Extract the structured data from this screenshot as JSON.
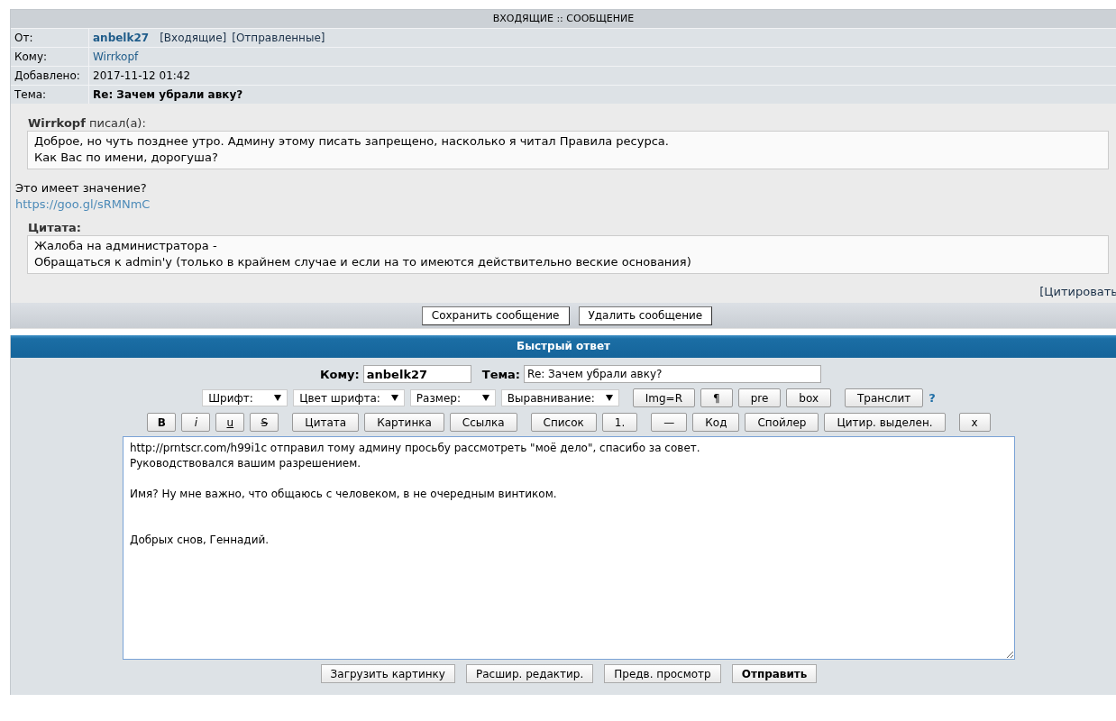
{
  "inbox": {
    "title": "ВХОДЯЩИЕ :: СООБЩЕНИЕ",
    "fields": [
      {
        "label": "От:",
        "kind": "sender",
        "value": "anbelk27",
        "links": [
          "[Входящие]",
          "[Отправленные]"
        ]
      },
      {
        "label": "Кому:",
        "kind": "link",
        "value": "Wirrkopf"
      },
      {
        "label": "Добавлено:",
        "kind": "text",
        "value": "2017-11-12 01:42"
      },
      {
        "label": "Тема:",
        "kind": "bold",
        "value": "Re: Зачем убрали авку?"
      }
    ],
    "body": [
      {
        "kind": "quote",
        "title": "**Wirrkopf** писал(а):",
        "lines": [
          "Доброе, но чуть позднее утро. Админу этому писать запрещено, насколько я читал Правила ресурса.",
          "Как Вас по имени, дорогуша?"
        ]
      },
      {
        "kind": "text",
        "text": "Это имеет значение?"
      },
      {
        "kind": "link",
        "text": "https://goo.gl/sRMNmC"
      },
      {
        "kind": "quote",
        "title": "**Цитата:**",
        "lines": [
          "Жалоба на администратора -",
          "Обращаться к admin'y (только в крайнем случае и если на то имеются действительно веские основания)"
        ]
      }
    ],
    "quote_link": "[Цитировать",
    "buttons": [
      "Сохранить сообщение",
      "Удалить сообщение"
    ]
  },
  "quick_reply": {
    "title": "Быстрый ответ",
    "to": {
      "label": "Кому:",
      "value": "anbelk27"
    },
    "subject": {
      "label": "Тема:",
      "value": "Re: Зачем убрали авку?"
    },
    "toolbar_1": [
      [
        {
          "kind": "select",
          "label": "Шрифт:"
        },
        {
          "kind": "select",
          "label": "Цвет шрифта:"
        },
        {
          "kind": "select",
          "label": "Размер:"
        },
        {
          "kind": "select",
          "label": "Выравнивание:"
        }
      ],
      [
        {
          "kind": "button",
          "label": "Img=R"
        },
        {
          "kind": "button",
          "label": "¶"
        },
        {
          "kind": "button",
          "label": "pre"
        },
        {
          "kind": "button",
          "label": "box"
        }
      ],
      [
        {
          "kind": "button",
          "label": "Транслит"
        },
        {
          "kind": "help",
          "label": "?"
        }
      ]
    ],
    "toolbar_2": [
      [
        {
          "kind": "bold",
          "label": "B"
        },
        {
          "kind": "italic",
          "label": "i"
        },
        {
          "kind": "underline",
          "label": "u"
        },
        {
          "kind": "strike",
          "label": "S"
        }
      ],
      [
        {
          "kind": "button",
          "label": "Цитата"
        },
        {
          "kind": "button",
          "label": "Картинка"
        },
        {
          "kind": "button",
          "label": "Ссылка"
        }
      ],
      [
        {
          "kind": "button",
          "label": "Список"
        },
        {
          "kind": "button",
          "label": "1."
        }
      ],
      [
        {
          "kind": "button",
          "label": "—"
        },
        {
          "kind": "button",
          "label": "Код"
        },
        {
          "kind": "button",
          "label": "Спойлер"
        },
        {
          "kind": "button",
          "label": "Цитир. выделен."
        }
      ],
      [
        {
          "kind": "button",
          "label": "x"
        }
      ]
    ],
    "message": "http://prntscr.com/h99i1c отправил тому админу просьбу рассмотреть \"моё дело\", спасибо за совет.\nРуководствовался вашим разрешением.\n\nИмя? Ну мне важно, что общаюсь с человеком, в не очередным винтиком.\n\n\nДобрых снов, Геннадий.",
    "buttons": [
      {
        "label": "Загрузить картинку",
        "primary": false
      },
      {
        "label": "Расшир. редактир.",
        "primary": false
      },
      {
        "label": "Предв. просмотр",
        "primary": false
      },
      {
        "label": "Отправить",
        "primary": true
      }
    ]
  }
}
